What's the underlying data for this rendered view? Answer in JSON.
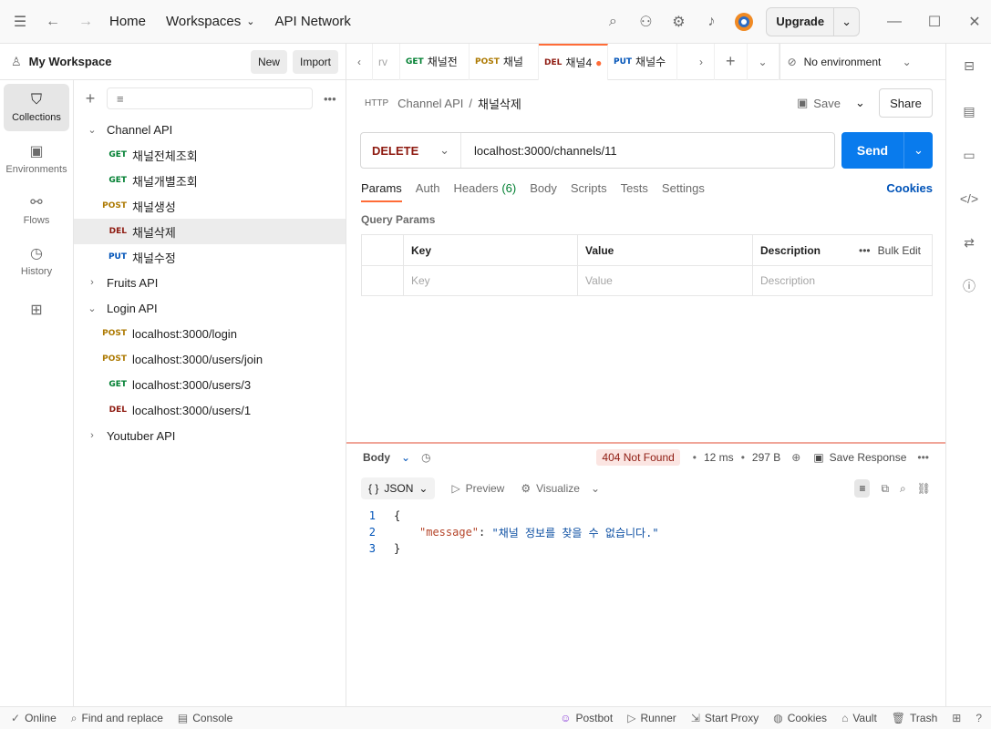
{
  "titlebar": {
    "home": "Home",
    "workspaces": "Workspaces",
    "api_network": "API Network",
    "upgrade": "Upgrade"
  },
  "workspace": {
    "name": "My Workspace",
    "new_label": "New",
    "import_label": "Import"
  },
  "rail": [
    {
      "label": "Collections"
    },
    {
      "label": "Environments"
    },
    {
      "label": "Flows"
    },
    {
      "label": "History"
    }
  ],
  "tree": {
    "collections": [
      {
        "name": "Channel API",
        "expanded": true,
        "items": [
          {
            "method": "GET",
            "name": "채널전체조회"
          },
          {
            "method": "GET",
            "name": "채널개별조회"
          },
          {
            "method": "POST",
            "name": "채널생성"
          },
          {
            "method": "DEL",
            "name": "채널삭제",
            "selected": true
          },
          {
            "method": "PUT",
            "name": "채널수정"
          }
        ]
      },
      {
        "name": "Fruits API",
        "expanded": false,
        "items": []
      },
      {
        "name": "Login API",
        "expanded": true,
        "items": [
          {
            "method": "POST",
            "name": "localhost:3000/login"
          },
          {
            "method": "POST",
            "name": "localhost:3000/users/join"
          },
          {
            "method": "GET",
            "name": "localhost:3000/users/3"
          },
          {
            "method": "DEL",
            "name": "localhost:3000/users/1"
          }
        ]
      },
      {
        "name": "Youtuber API",
        "expanded": false,
        "items": []
      }
    ]
  },
  "tabs": [
    {
      "method": "",
      "name": "rv"
    },
    {
      "method": "GET",
      "name": "채널전"
    },
    {
      "method": "POST",
      "name": "채널"
    },
    {
      "method": "DEL",
      "name": "채널4",
      "active": true
    },
    {
      "method": "PUT",
      "name": "채널수"
    }
  ],
  "environment": "No environment",
  "request": {
    "breadcrumb_parent": "Channel API",
    "breadcrumb_sep": "/",
    "title": "채널삭제",
    "save_label": "Save",
    "share_label": "Share",
    "method": "DELETE",
    "url": "localhost:3000/channels/11",
    "send_label": "Send",
    "tabs": [
      "Params",
      "Auth",
      "Headers",
      "Body",
      "Scripts",
      "Tests",
      "Settings"
    ],
    "headers_count": "(6)",
    "cookies_label": "Cookies",
    "query_params_title": "Query Params",
    "columns": {
      "key": "Key",
      "value": "Value",
      "description": "Description",
      "bulk_edit": "Bulk Edit"
    },
    "placeholders": {
      "key": "Key",
      "value": "Value",
      "description": "Description"
    }
  },
  "response": {
    "body_label": "Body",
    "status": "404 Not Found",
    "time": "12 ms",
    "size": "297 B",
    "save_response": "Save Response",
    "format": "JSON",
    "preview": "Preview",
    "visualize": "Visualize",
    "lines": [
      {
        "num": "1",
        "text": "{"
      },
      {
        "num": "2",
        "key": "\"message\"",
        "colon": ": ",
        "value": "\"채널 정보를 찾을 수 없습니다.\""
      },
      {
        "num": "3",
        "text": "}"
      }
    ]
  },
  "statusbar": {
    "online": "Online",
    "find_replace": "Find and replace",
    "console": "Console",
    "postbot": "Postbot",
    "runner": "Runner",
    "start_proxy": "Start Proxy",
    "cookies": "Cookies",
    "vault": "Vault",
    "trash": "Trash"
  }
}
